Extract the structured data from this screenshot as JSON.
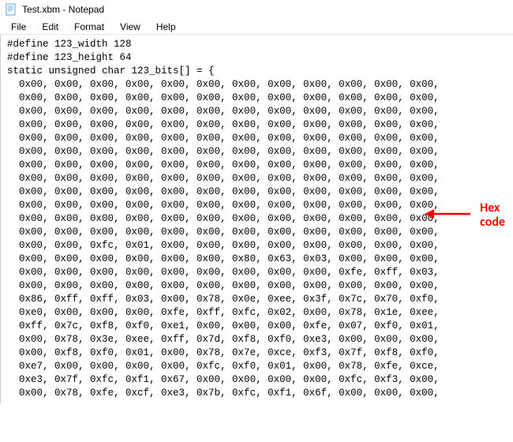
{
  "window": {
    "title": "Test.xbm - Notepad"
  },
  "menu": {
    "file": "File",
    "edit": "Edit",
    "format": "Format",
    "view": "View",
    "help": "Help"
  },
  "code": {
    "lines": [
      "#define 123_width 128",
      "#define 123_height 64",
      "static unsigned char 123_bits[] = {",
      "  0x00, 0x00, 0x00, 0x00, 0x00, 0x00, 0x00, 0x00, 0x00, 0x00, 0x00, 0x00,",
      "  0x00, 0x00, 0x00, 0x00, 0x00, 0x00, 0x00, 0x00, 0x00, 0x00, 0x00, 0x00,",
      "  0x00, 0x00, 0x00, 0x00, 0x00, 0x00, 0x00, 0x00, 0x00, 0x00, 0x00, 0x00,",
      "  0x00, 0x00, 0x00, 0x00, 0x00, 0x00, 0x00, 0x00, 0x00, 0x00, 0x00, 0x00,",
      "  0x00, 0x00, 0x00, 0x00, 0x00, 0x00, 0x00, 0x00, 0x00, 0x00, 0x00, 0x00,",
      "  0x00, 0x00, 0x00, 0x00, 0x00, 0x00, 0x00, 0x00, 0x00, 0x00, 0x00, 0x00,",
      "  0x00, 0x00, 0x00, 0x00, 0x00, 0x00, 0x00, 0x00, 0x00, 0x00, 0x00, 0x00,",
      "  0x00, 0x00, 0x00, 0x00, 0x00, 0x00, 0x00, 0x00, 0x00, 0x00, 0x00, 0x00,",
      "  0x00, 0x00, 0x00, 0x00, 0x00, 0x00, 0x00, 0x00, 0x00, 0x00, 0x00, 0x00,",
      "  0x00, 0x00, 0x00, 0x00, 0x00, 0x00, 0x00, 0x00, 0x00, 0x00, 0x00, 0x00,",
      "  0x00, 0x00, 0x00, 0x00, 0x00, 0x00, 0x00, 0x00, 0x00, 0x00, 0x00, 0x00,",
      "  0x00, 0x00, 0x00, 0x00, 0x00, 0x00, 0x00, 0x00, 0x00, 0x00, 0x00, 0x00,",
      "  0x00, 0x00, 0xfc, 0x01, 0x00, 0x00, 0x00, 0x00, 0x00, 0x00, 0x00, 0x00,",
      "  0x00, 0x00, 0x00, 0x00, 0x00, 0x00, 0x80, 0x63, 0x03, 0x00, 0x00, 0x00,",
      "  0x00, 0x00, 0x00, 0x00, 0x00, 0x00, 0x00, 0x00, 0x00, 0xfe, 0xff, 0x03,",
      "  0x00, 0x00, 0x00, 0x00, 0x00, 0x00, 0x00, 0x00, 0x00, 0x00, 0x00, 0x00,",
      "  0x86, 0xff, 0xff, 0x03, 0x00, 0x78, 0x0e, 0xee, 0x3f, 0x7c, 0x70, 0xf0,",
      "  0xe0, 0x00, 0x00, 0x00, 0xfe, 0xff, 0xfc, 0x02, 0x00, 0x78, 0x1e, 0xee,",
      "  0xff, 0x7c, 0xf8, 0xf0, 0xe1, 0x00, 0x00, 0x00, 0xfe, 0x07, 0xf0, 0x01,",
      "  0x00, 0x78, 0x3e, 0xee, 0xff, 0x7d, 0xf8, 0xf0, 0xe3, 0x00, 0x00, 0x00,",
      "  0x00, 0xf8, 0xf0, 0x01, 0x00, 0x78, 0x7e, 0xce, 0xf3, 0x7f, 0xf8, 0xf0,",
      "  0xe7, 0x00, 0x00, 0x00, 0x00, 0xfc, 0xf0, 0x01, 0x00, 0x78, 0xfe, 0xce,",
      "  0xe3, 0x7f, 0xfc, 0xf1, 0x67, 0x00, 0x00, 0x00, 0x00, 0xfc, 0xf3, 0x00,",
      "  0x00, 0x78, 0xfe, 0xcf, 0xe3, 0x7b, 0xfc, 0xf1, 0x6f, 0x00, 0x00, 0x00,"
    ]
  },
  "annotation": {
    "line1": "Hex",
    "line2": "code"
  }
}
